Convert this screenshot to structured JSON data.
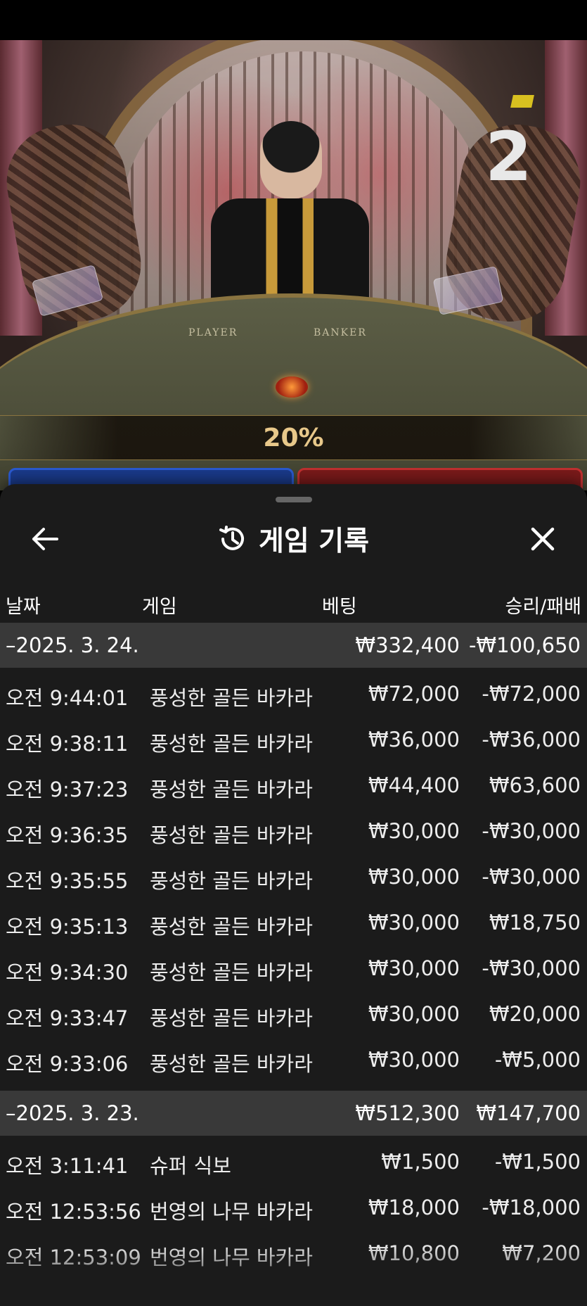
{
  "video": {
    "round_count": "2",
    "table_labels": {
      "player": "PLAYER",
      "banker": "BANKER"
    },
    "multiplier_percent": "20%"
  },
  "panel": {
    "title": "게임 기록",
    "icons": {
      "back": "arrow-left-icon",
      "history": "history-clock-icon",
      "close": "close-x-icon"
    },
    "columns": {
      "date": "날짜",
      "game": "게임",
      "bet": "베팅",
      "result": "승리/패배"
    },
    "days": [
      {
        "date": "–2025. 3. 24.",
        "total_bet": "₩332,400",
        "total_result": "-₩100,650",
        "rows": [
          {
            "time": "오전 9:44:01",
            "game": "풍성한 골든 바카라",
            "bet": "₩72,000",
            "result": "-₩72,000"
          },
          {
            "time": "오전 9:38:11",
            "game": "풍성한 골든 바카라",
            "bet": "₩36,000",
            "result": "-₩36,000"
          },
          {
            "time": "오전 9:37:23",
            "game": "풍성한 골든 바카라",
            "bet": "₩44,400",
            "result": "₩63,600"
          },
          {
            "time": "오전 9:36:35",
            "game": "풍성한 골든 바카라",
            "bet": "₩30,000",
            "result": "-₩30,000"
          },
          {
            "time": "오전 9:35:55",
            "game": "풍성한 골든 바카라",
            "bet": "₩30,000",
            "result": "-₩30,000"
          },
          {
            "time": "오전 9:35:13",
            "game": "풍성한 골든 바카라",
            "bet": "₩30,000",
            "result": "₩18,750"
          },
          {
            "time": "오전 9:34:30",
            "game": "풍성한 골든 바카라",
            "bet": "₩30,000",
            "result": "-₩30,000"
          },
          {
            "time": "오전 9:33:47",
            "game": "풍성한 골든 바카라",
            "bet": "₩30,000",
            "result": "₩20,000"
          },
          {
            "time": "오전 9:33:06",
            "game": "풍성한 골든 바카라",
            "bet": "₩30,000",
            "result": "-₩5,000"
          }
        ]
      },
      {
        "date": "–2025. 3. 23.",
        "total_bet": "₩512,300",
        "total_result": "₩147,700",
        "rows": [
          {
            "time": "오전 3:11:41",
            "game": "슈퍼 식보",
            "bet": "₩1,500",
            "result": "-₩1,500"
          },
          {
            "time": "오전 12:53:56",
            "game": "번영의 나무 바카라",
            "bet": "₩18,000",
            "result": "-₩18,000"
          },
          {
            "time": "오전 12:53:09",
            "game": "번영의 나무 바카라",
            "bet": "₩10,800",
            "result": "₩7,200"
          }
        ]
      }
    ]
  },
  "colors": {
    "panel_bg": "#1b1b1b",
    "day_row_bg": "#393939",
    "player_blue": "#1a3a8a",
    "banker_red": "#7a1a1a",
    "gold": "#e8c88a"
  }
}
